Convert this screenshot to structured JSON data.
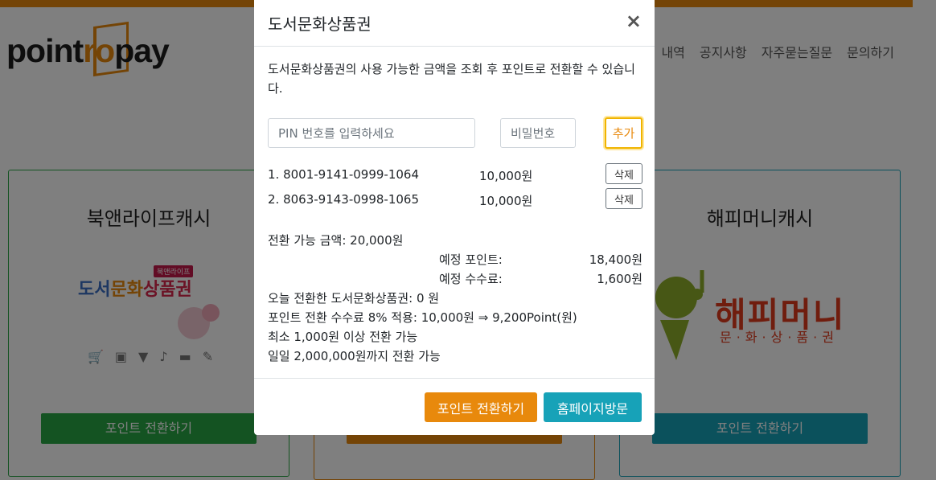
{
  "brand": {
    "name_part1": "point",
    "name_part2": "ro",
    "name_part3": "pay",
    "accent": "#e8890c"
  },
  "nav": {
    "items": [
      "내역",
      "공지사항",
      "자주묻는질문",
      "문의하기"
    ]
  },
  "cards": [
    {
      "title": "북앤라이프캐시",
      "button": "포인트 전환하기",
      "color": "#28a745",
      "logo": {
        "part1": "도서",
        "part2": "문화",
        "part3": "상품권",
        "badge": "북앤라이프"
      }
    },
    {
      "title": "",
      "button": "",
      "color": "#e8890c"
    },
    {
      "title": "해피머니캐시",
      "button": "포인트 전환하기",
      "color": "#17a2b8",
      "logo": {
        "main": "해피머니",
        "sub": "문·화·상·품·권"
      }
    }
  ],
  "modal": {
    "title": "도서문화상품권",
    "close_label": "×",
    "description": "도서문화상품권의 사용 가능한 금액을 조회 후 포인트로 전환할 수 있습니다.",
    "pin_placeholder": "PIN 번호를 입력하세요",
    "password_placeholder": "비밀번호",
    "add_label": "추가",
    "items": [
      {
        "pin": "1. 8001-9141-0999-1064",
        "amount": "10,000원",
        "delete_label": "삭제"
      },
      {
        "pin": "2. 8063-9143-0998-1065",
        "amount": "10,000원",
        "delete_label": "삭제"
      }
    ],
    "convertible": "전환 가능 금액: 20,000원",
    "expected_points_label": "예정 포인트:",
    "expected_points_value": "18,400원",
    "expected_fee_label": "예정 수수료:",
    "expected_fee_value": "1,600원",
    "today_converted": "오늘 전환한 도서문화상품권: 0 원",
    "fee_note": "포인트 전환 수수료 8% 적용: 10,000원 ⇒ 9,200Point(원)",
    "min_note": "최소 1,000원 이상 전환 가능",
    "daily_note": "일일 2,000,000원까지 전환 가능",
    "convert_button": "포인트 전환하기",
    "home_button": "홈페이지방문"
  }
}
